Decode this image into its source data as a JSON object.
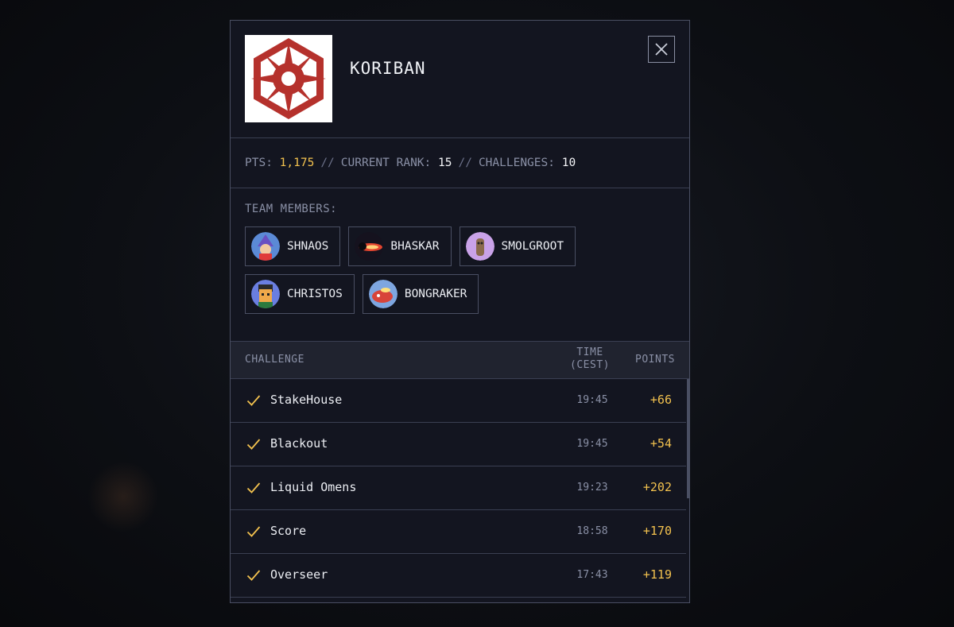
{
  "team": {
    "name": "KORIBAN",
    "logo": "sith-empire-emblem"
  },
  "close_icon": "close-icon",
  "stats": {
    "pts_label": "PTS:",
    "pts": "1,175",
    "sep": "//",
    "rank_label": "CURRENT RANK:",
    "rank": "15",
    "challenges_label": "CHALLENGES:",
    "challenges": "10"
  },
  "members_title": "TEAM MEMBERS:",
  "members": [
    {
      "name": "SHNAOS"
    },
    {
      "name": "BHASKAR"
    },
    {
      "name": "SMOLGROOT"
    },
    {
      "name": "CHRISTOS"
    },
    {
      "name": "BONGRAKER"
    }
  ],
  "table": {
    "col_challenge": "CHALLENGE",
    "col_time_line1": "TIME",
    "col_time_line2": "(CEST)",
    "col_points": "POINTS",
    "rows": [
      {
        "name": "StakeHouse",
        "time": "19:45",
        "points": "+66"
      },
      {
        "name": "Blackout",
        "time": "19:45",
        "points": "+54"
      },
      {
        "name": "Liquid Omens",
        "time": "19:23",
        "points": "+202"
      },
      {
        "name": "Score",
        "time": "18:58",
        "points": "+170"
      },
      {
        "name": "Overseer",
        "time": "17:43",
        "points": "+119"
      }
    ]
  },
  "colors": {
    "accent": "#f2c14e",
    "panel": "#131520",
    "border": "#4a4f63",
    "logo_red": "#b5312c"
  }
}
